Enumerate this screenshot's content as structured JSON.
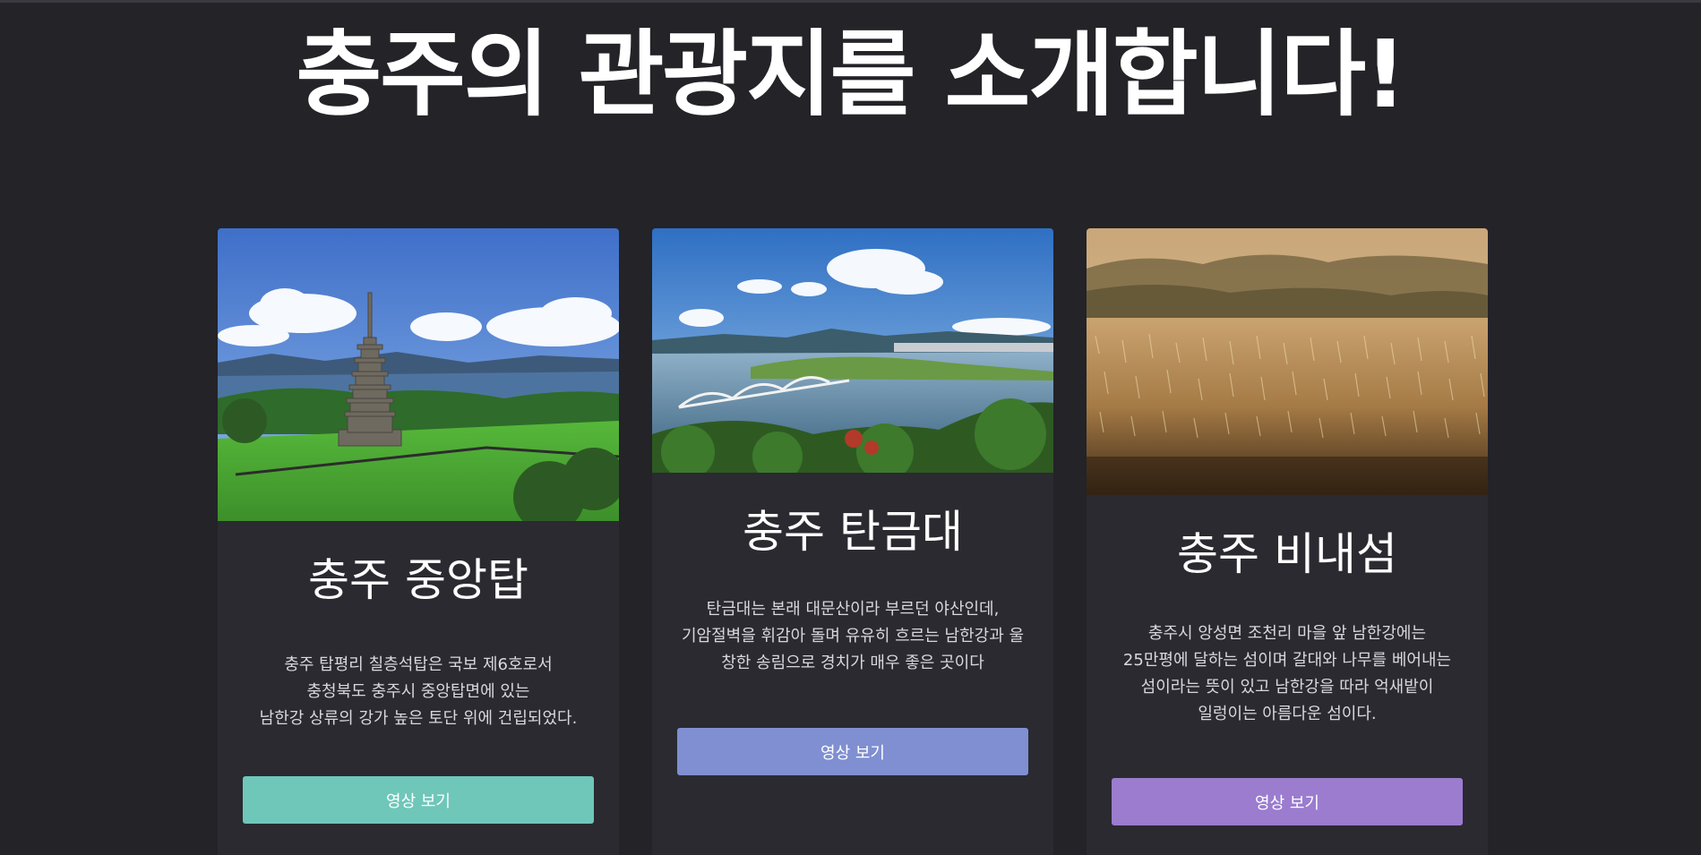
{
  "page": {
    "title": "충주의 관광지를 소개합니다!"
  },
  "cards": [
    {
      "title": "충주 중앙탑",
      "description": [
        "충주 탑평리 칠층석탑은 국보 제6호로서",
        "충청북도 충주시 중앙탑면에 있는",
        "남한강 상류의 강가 높은 토단 위에 건립되었다."
      ],
      "button_label": "영상 보기",
      "button_color": "#6fc7b9",
      "image_icon": "pagoda-landscape-image"
    },
    {
      "title": "충주 탄금대",
      "description": [
        "탄금대는 본래 대문산이라 부르던 야산인데,",
        "기암절벽을 휘감아 돌며 유유히 흐르는 남한강과 울",
        "창한 송림으로 경치가 매우 좋은 곳이다"
      ],
      "button_label": "영상 보기",
      "button_color": "#7f8fd1",
      "image_icon": "river-bridge-image"
    },
    {
      "title": "충주 비내섬",
      "description": [
        "충주시 앙성면 조천리 마을 앞 남한강에는",
        "25만평에 달하는 섬이며 갈대와 나무를 베어내는",
        "섬이라는 뜻이 있고 남한강을 따라 억새밭이",
        "일렁이는 아름다운 섬이다."
      ],
      "button_label": "영상 보기",
      "button_color": "#9b7ccf",
      "image_icon": "reed-field-image"
    }
  ]
}
